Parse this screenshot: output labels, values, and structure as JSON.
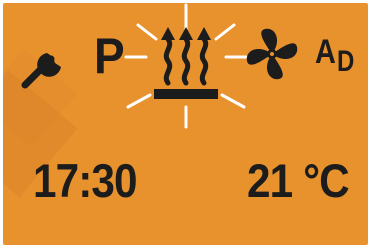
{
  "status_icons": {
    "service_icon": "wrench-icon",
    "mode_label": "P",
    "heating_icon": "heating-active-icon",
    "fan_icon": "fan-icon",
    "auto_label_main": "A",
    "auto_label_sub": "D"
  },
  "readouts": {
    "time": "17:30",
    "temperature": "21 °C"
  },
  "colors": {
    "background": "#e8922e",
    "foreground": "#1c1c1c",
    "glow": "#ffffff"
  }
}
